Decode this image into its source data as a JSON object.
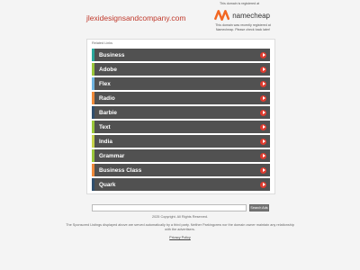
{
  "header": {
    "domain": "jlexidesignsandcompany.com",
    "registered_text": "This domain is registered at",
    "registrar_name": "namecheap",
    "registrar_note": "This domain was recently registered at Namecheap. Please check back later!"
  },
  "related": {
    "title": "Related Links",
    "items": [
      {
        "label": "Business",
        "accent": "#2aa79b"
      },
      {
        "label": "Adobe",
        "accent": "#9ac73a"
      },
      {
        "label": "Flex",
        "accent": "#6fb4e0"
      },
      {
        "label": "Radio",
        "accent": "#f08a3a"
      },
      {
        "label": "Barbie",
        "accent": "#2f4f6e"
      },
      {
        "label": "Text",
        "accent": "#9ac73a"
      },
      {
        "label": "India",
        "accent": "#c7d44a"
      },
      {
        "label": "Grammar",
        "accent": "#9ac73a"
      },
      {
        "label": "Business Class",
        "accent": "#f08a3a"
      },
      {
        "label": "Quark",
        "accent": "#2f4f6e"
      }
    ]
  },
  "search": {
    "placeholder": "",
    "button_label": "Search Ads"
  },
  "footer": {
    "copyright": "2025 Copyright. All Rights Reserved.",
    "disclaimer": "The Sponsored Listings displayed above are served automatically by a third party. Neither Parkingcrew nor the domain owner maintain any relationship with the advertisers.",
    "privacy": "Privacy Policy"
  },
  "colors": {
    "brand": "#c0392b",
    "item_bg": "#515151",
    "arrow": "#e03b2f",
    "namecheap_orange": "#f26722"
  }
}
